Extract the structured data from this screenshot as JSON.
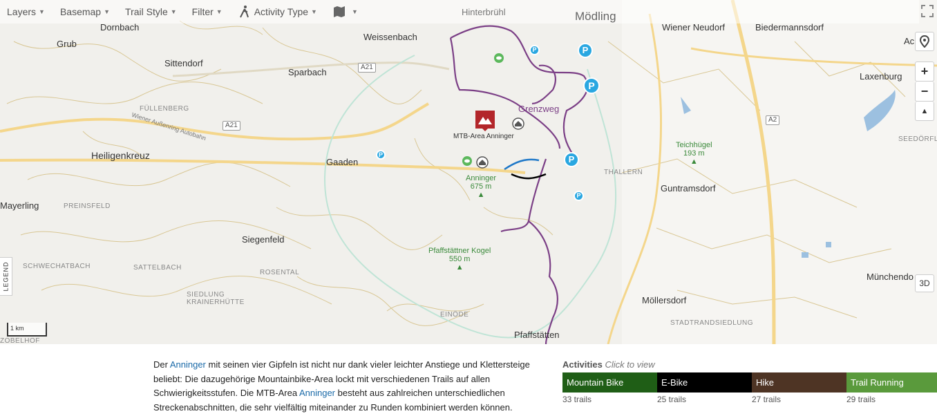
{
  "toolbar": {
    "layers": "Layers",
    "basemap": "Basemap",
    "trail_style": "Trail Style",
    "filter": "Filter",
    "activity_type": "Activity Type"
  },
  "places": {
    "hinterbruhl": "Hinterbrühl",
    "modling": "Mödling",
    "wiener_neudorf": "Wiener Neudorf",
    "biedermannsdorf": "Biedermannsdorf",
    "ach": "Ac",
    "dornbach": "Dornbach",
    "weissenbach": "Weissenbach",
    "grub": "Grub",
    "sittendorf": "Sittendorf",
    "sparbach": "Sparbach",
    "fullenberg": "FÜLLENBERG",
    "heiligenkreuz": "Heiligenkreuz",
    "gaaden": "Gaaden",
    "mtb_area": "MTB-Area Anninger",
    "grenzweg": "Grenzweg",
    "laxenburg": "Laxenburg",
    "seedorfl": "SEEDÖRFL",
    "teichhugel": "Teichhügel",
    "teichhugel_elev": "193 m",
    "thallern": "THALLERN",
    "anninger": "Anninger",
    "anninger_elev": "675 m",
    "guntramsdorf": "Guntramsdorf",
    "mayerling": "Mayerling",
    "preinsfeld": "PREINSFELD",
    "siegenfeld": "Siegenfeld",
    "schwechatbach": "SCHWECHATBACH",
    "sattelbach": "SATTELBACH",
    "rosental": "ROSENTAL",
    "pfaffstattner_kogel": "Pfaffstättner Kogel",
    "pfaffstattner_elev": "550 m",
    "munchendorf": "Münchendo",
    "siedlung_krainerhutte_1": "SIEDLUNG",
    "siedlung_krainerhutte_2": "KRAINERHÜTTE",
    "mollersdorf": "Möllersdorf",
    "einode": "EINÖDE",
    "stadtrandsiedlung": "STADTRANDSIEDLUNG",
    "zobelhof": "ZOBELHOF",
    "pfaffstatten": "Pfaffstätten",
    "wiener_aussenring": "Wiener Außenring Autobahn"
  },
  "roads": {
    "a21_top": "A21",
    "a21_left": "A21",
    "a2": "A2"
  },
  "map_controls": {
    "zoom_in": "+",
    "zoom_out": "−",
    "compass": "▲",
    "three_d": "3D",
    "legend": "LEGEND",
    "scale": "1 km"
  },
  "description": {
    "part1": "Der ",
    "link1": "Anninger",
    "part2": " mit seinen vier Gipfeln ist nicht nur dank vieler leichter Anstiege und Klettersteige beliebt: Die dazugehörige Mountainbike-Area lockt mit verschiedenen Trails auf allen Schwierigkeitsstufen. Die MTB-Area ",
    "link2": "Anninger",
    "part3": " besteht aus zahlreichen unterschiedlichen Streckenabschnitten, die sehr vielfältig miteinander zu Runden kombiniert werden können."
  },
  "activities": {
    "title": "Activities",
    "hint": "Click to view",
    "items": [
      {
        "label": "Mountain Bike",
        "count": "33 trails",
        "color": "#1f5e16"
      },
      {
        "label": "E-Bike",
        "count": "25 trails",
        "color": "#000000"
      },
      {
        "label": "Hike",
        "count": "27 trails",
        "color": "#4e3424"
      },
      {
        "label": "Trail Running",
        "count": "29 trails",
        "color": "#5a9a3c"
      }
    ]
  },
  "colors": {
    "trail_purple": "#7b3f86",
    "trail_blue": "#1e78c8",
    "parking_blue": "#29a7e1",
    "peak_green": "#3b8a3b",
    "motorway": "#f4d68b",
    "mtb_marker": "#b3262a"
  }
}
